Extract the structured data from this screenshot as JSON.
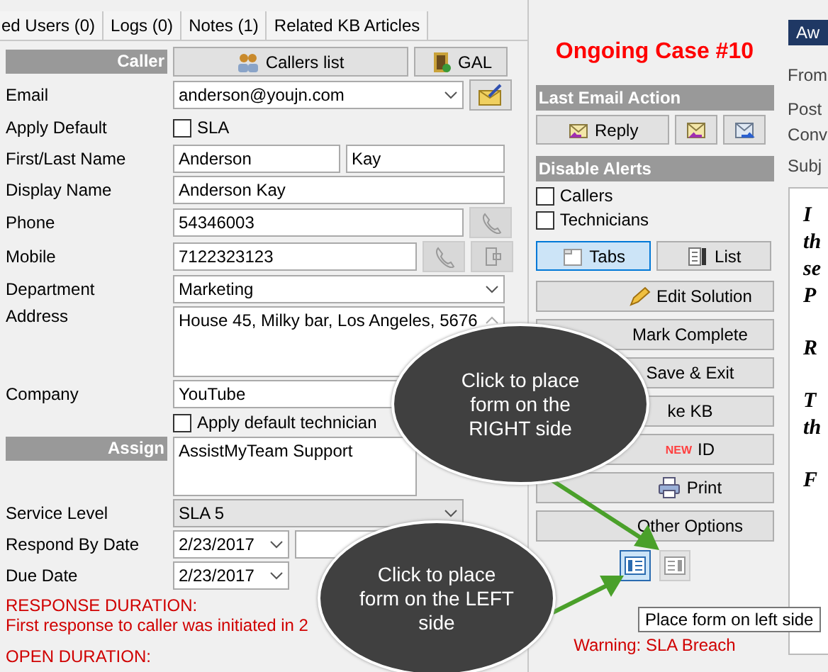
{
  "tabs": [
    "ed Users (0)",
    "Logs (0)",
    "Notes (1)",
    "Related KB Articles"
  ],
  "caller": {
    "header": "Caller",
    "callers_button": "Callers list",
    "gal_button": "GAL"
  },
  "email": {
    "label": "Email",
    "value": "anderson@youjn.com"
  },
  "apply_default": {
    "label": "Apply Default",
    "option": "SLA",
    "checked": false
  },
  "name": {
    "label": "First/Last Name",
    "first": "Anderson",
    "last": "Kay"
  },
  "display_name": {
    "label": "Display Name",
    "value": "Anderson Kay"
  },
  "phone": {
    "label": "Phone",
    "value": "54346003"
  },
  "mobile": {
    "label": "Mobile",
    "value": "7122323123"
  },
  "department": {
    "label": "Department",
    "value": "Marketing"
  },
  "address": {
    "label": "Address",
    "value": "House 45, Milky bar, Los Angeles, 5676"
  },
  "company": {
    "label": "Company",
    "value": "YouTube"
  },
  "default_tech": {
    "label": "Apply default technician",
    "checked": false
  },
  "assign": {
    "header": "Assign",
    "value": "AssistMyTeam Support"
  },
  "service_level": {
    "label": "Service Level",
    "value": "SLA 5"
  },
  "respond_by": {
    "label": "Respond By Date",
    "date": "2/23/2017"
  },
  "due": {
    "label": "Due Date",
    "date": "2/23/2017"
  },
  "durations": [
    "RESPONSE DURATION:",
    "First response to caller was initiated in 2",
    "OPEN DURATION:"
  ],
  "case_title": "Ongoing Case #10",
  "email_action": {
    "header": "Last Email Action",
    "reply": "Reply"
  },
  "alerts": {
    "header": "Disable Alerts",
    "options": [
      {
        "label": "Callers",
        "checked": false
      },
      {
        "label": "Technicians",
        "checked": false
      }
    ]
  },
  "view": [
    {
      "label": "Tabs",
      "selected": true
    },
    {
      "label": "List",
      "selected": false
    }
  ],
  "actions": [
    {
      "label": "Edit Solution",
      "kind": "edit"
    },
    {
      "label": "Mark Complete",
      "kind": "plain"
    },
    {
      "label": "Save & Exit",
      "kind": "plain"
    },
    {
      "label": "ke KB",
      "kind": "plain"
    },
    {
      "label": "ID",
      "kind": "new",
      "badge": "NEW"
    },
    {
      "label": "Print",
      "kind": "print"
    },
    {
      "label": "Other Options",
      "kind": "plain"
    }
  ],
  "form_placement": [
    {
      "selected": true
    },
    {
      "selected": false
    }
  ],
  "tooltip": "Place form on left side",
  "warning": "Warning: SLA Breach",
  "callouts": [
    "Click to place form on the RIGHT side",
    "Click to place form on the LEFT side"
  ],
  "email_pane": {
    "button": "Aw",
    "fields": [
      "From",
      "Post",
      "Conv",
      "Subj"
    ],
    "body": [
      [
        "I",
        "th",
        "se",
        "P"
      ],
      [
        "R"
      ],
      [
        "T",
        "th"
      ],
      [
        "F"
      ]
    ]
  }
}
